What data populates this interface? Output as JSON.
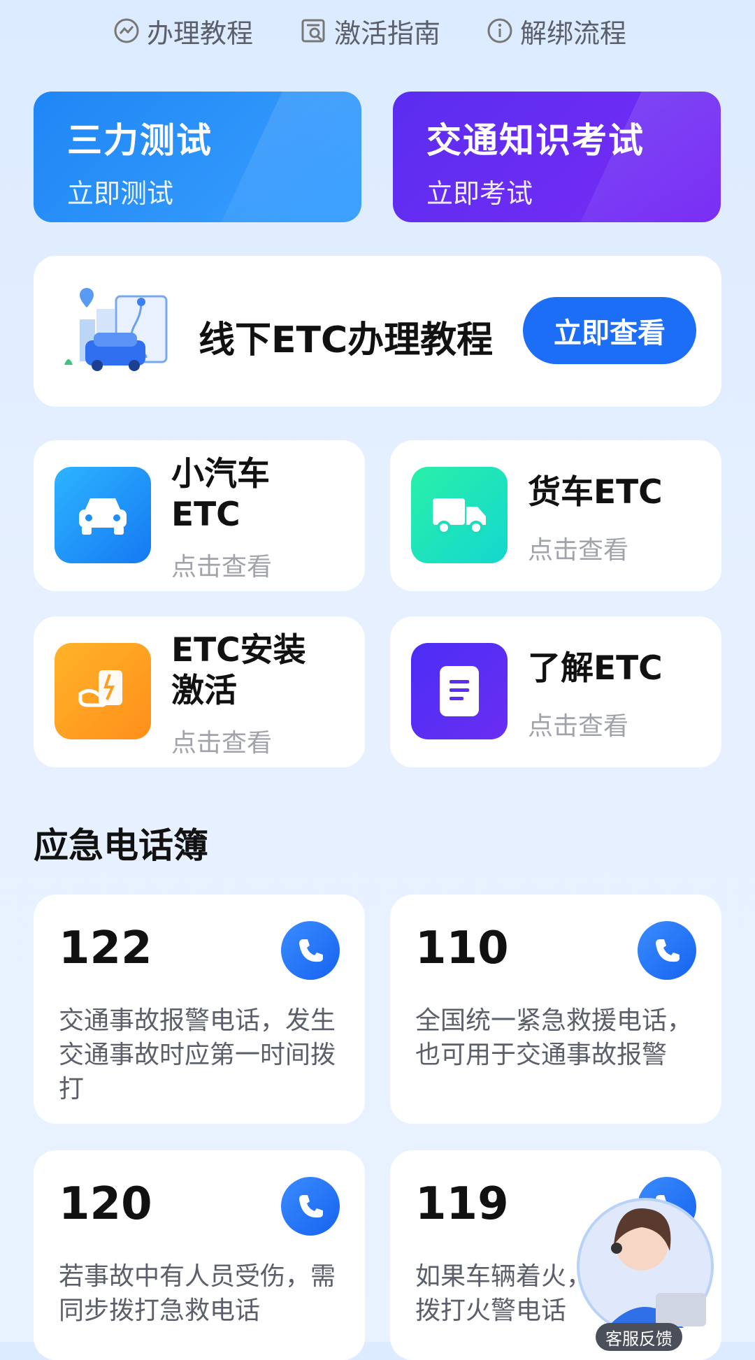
{
  "top_links": [
    {
      "label": "办理教程",
      "icon": "trend-circle-icon"
    },
    {
      "label": "激活指南",
      "icon": "doc-search-icon"
    },
    {
      "label": "解绑流程",
      "icon": "info-circle-icon"
    }
  ],
  "banners": [
    {
      "title": "三力测试",
      "subtitle": "立即测试",
      "gradient": [
        "#1f86f5",
        "#3aa0ff"
      ]
    },
    {
      "title": "交通知识考试",
      "subtitle": "立即考试",
      "gradient": [
        "#5a2df0",
        "#7a2cf5"
      ]
    }
  ],
  "etc_tutorial": {
    "title": "线下ETC办理教程",
    "button": "立即查看",
    "icon": "map-car-illustration"
  },
  "tiles": [
    {
      "title_line1": "小汽车",
      "title_line2": "ETC",
      "sub": "点击查看",
      "icon": "car-icon",
      "color": [
        "#2db4ff",
        "#1579f3"
      ]
    },
    {
      "title_line1": "货车ETC",
      "title_line2": "",
      "sub": "点击查看",
      "icon": "truck-icon",
      "color": [
        "#29f0a8",
        "#14d7cf"
      ]
    },
    {
      "title_line1": "ETC安装",
      "title_line2": "激活",
      "sub": "点击查看",
      "icon": "install-hand-icon",
      "color": [
        "#ffb32a",
        "#ff8f1a"
      ]
    },
    {
      "title_line1": "了解ETC",
      "title_line2": "",
      "sub": "点击查看",
      "icon": "document-icon",
      "color": [
        "#4b2df5",
        "#6a2ef2"
      ]
    }
  ],
  "emergency": {
    "title": "应急电话簿",
    "items": [
      {
        "number": "122",
        "desc": "交通事故报警电话，发生交通事故时应第一时间拨打"
      },
      {
        "number": "110",
        "desc": "全国统一紧急救援电话，也可用于交通事故报警"
      },
      {
        "number": "120",
        "desc": "若事故中有人员受伤，需同步拨打急救电话"
      },
      {
        "number": "119",
        "desc": "如果车辆着火，拨打火警电话"
      }
    ]
  },
  "customer_service": {
    "label": "客服反馈"
  }
}
